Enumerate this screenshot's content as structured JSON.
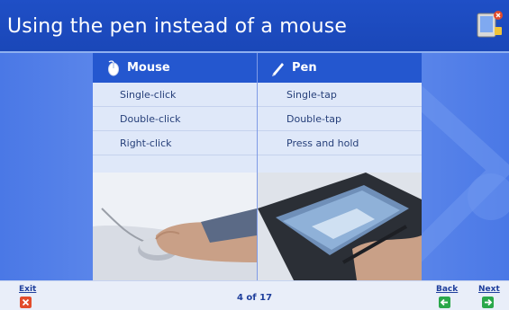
{
  "header": {
    "title": "Using the pen instead of a mouse"
  },
  "columns": {
    "mouse": {
      "heading": "Mouse",
      "items": [
        "Single-click",
        "Double-click",
        "Right-click"
      ]
    },
    "pen": {
      "heading": "Pen",
      "items": [
        "Single-tap",
        "Double-tap",
        "Press and hold"
      ]
    }
  },
  "footer": {
    "exit_label": "Exit",
    "page_indicator": "4 of 17",
    "back_label": "Back",
    "next_label": "Next"
  },
  "colors": {
    "header_blue": "#1f4fc6",
    "column_head": "#2457cf",
    "exit_red": "#e24b2b",
    "nav_green": "#2aa84a"
  }
}
